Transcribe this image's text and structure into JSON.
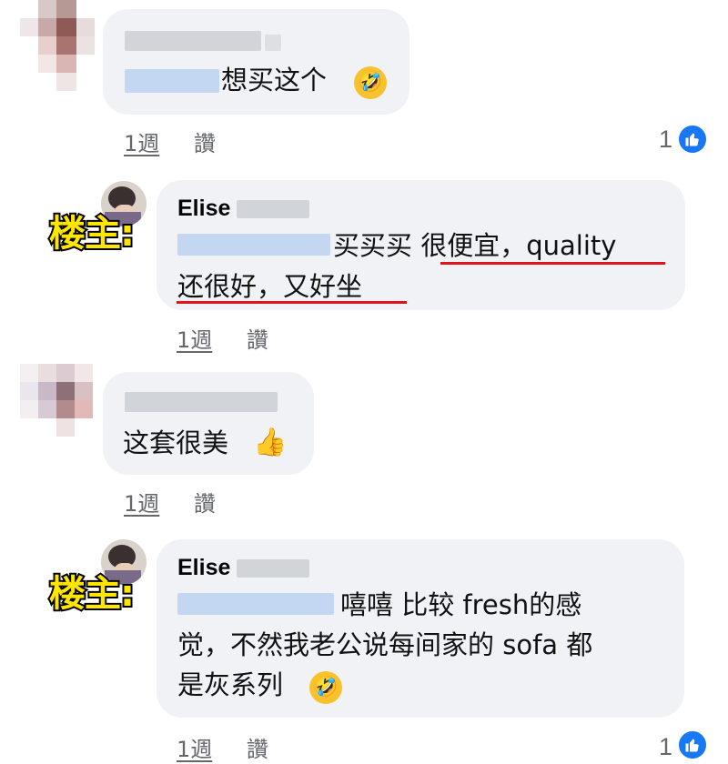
{
  "comments": [
    {
      "id": "c1",
      "author_name": "",
      "text": "想买这个",
      "emoji": "rofl-emoji",
      "time": "1週",
      "like_action": "讚",
      "reaction_count": "1"
    },
    {
      "id": "c2",
      "author_name": "Elise",
      "tag": "楼主:",
      "text_line1": "买买买 很便宜，quality",
      "text_line2": "还很好，又好坐",
      "time": "1週",
      "like_action": "讚"
    },
    {
      "id": "c3",
      "author_name": "",
      "text": "这套很美",
      "emoji": "thumbs-up-emoji",
      "time": "1週",
      "like_action": "讚"
    },
    {
      "id": "c4",
      "author_name": "Elise",
      "tag": "楼主:",
      "text_line1": "嘻嘻 比较 fresh的感",
      "text_line2": "觉，不然我老公说每间家的 sofa 都",
      "text_line3": "是灰系列",
      "emoji": "rofl-emoji",
      "time": "1週",
      "like_action": "讚",
      "reaction_count": "1"
    }
  ],
  "colors": {
    "bubble_bg": "#f0f2f5",
    "meta_text": "#65676b",
    "like_blue": "#1877f2",
    "highlight_underline": "#e0141e",
    "tag_yellow": "#ffe600"
  }
}
